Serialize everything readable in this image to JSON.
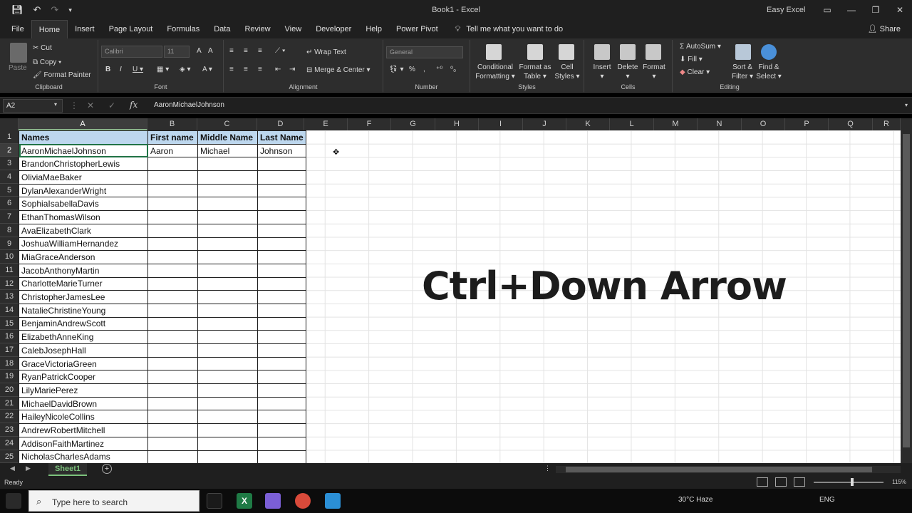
{
  "window": {
    "title": "Book1  -  Excel",
    "user": "Easy Excel"
  },
  "menu": {
    "tabs": [
      "File",
      "Home",
      "Insert",
      "Page Layout",
      "Formulas",
      "Data",
      "Review",
      "View",
      "Developer",
      "Help",
      "Power Pivot"
    ],
    "tell_me": "Tell me what you want to do",
    "share": "Share"
  },
  "ribbon": {
    "clipboard": {
      "label": "Clipboard",
      "paste": "Paste",
      "cut": "Cut",
      "copy": "Copy",
      "format_painter": "Format Painter"
    },
    "font": {
      "label": "Font",
      "font_name": "Calibri",
      "font_size": "11"
    },
    "alignment": {
      "label": "Alignment",
      "wrap_text": "Wrap Text",
      "merge_center": "Merge & Center"
    },
    "number": {
      "label": "Number",
      "format": "General"
    },
    "styles": {
      "label": "Styles",
      "conditional": [
        "Conditional",
        "Formatting"
      ],
      "format_table": [
        "Format as",
        "Table"
      ],
      "cell_styles": [
        "Cell",
        "Styles"
      ]
    },
    "cells": {
      "label": "Cells",
      "insert": "Insert",
      "delete": "Delete",
      "format": "Format"
    },
    "editing": {
      "label": "Editing",
      "autosum": "AutoSum",
      "fill": "Fill",
      "clear": "Clear",
      "sort_filter": [
        "Sort &",
        "Filter"
      ],
      "find_select": [
        "Find &",
        "Select"
      ]
    }
  },
  "formula_bar": {
    "name_box": "A2",
    "content": "AaronMichaelJohnson"
  },
  "grid": {
    "columns": [
      "A",
      "B",
      "C",
      "D",
      "E",
      "F",
      "G",
      "H",
      "I",
      "J",
      "K",
      "L",
      "M",
      "N",
      "O",
      "P",
      "Q",
      "R"
    ],
    "rows": [
      "1",
      "2",
      "3",
      "4",
      "5",
      "6",
      "7",
      "8",
      "9",
      "10",
      "11",
      "12",
      "13",
      "14",
      "15",
      "16",
      "17",
      "18",
      "19",
      "20",
      "21",
      "22",
      "23",
      "24",
      "25"
    ],
    "headers": [
      "Names",
      "First name",
      "Middle Name",
      "Last Name"
    ],
    "data": [
      [
        "AaronMichaelJohnson",
        "Aaron",
        "Michael",
        "Johnson"
      ],
      [
        "BrandonChristopherLewis",
        "",
        "",
        ""
      ],
      [
        "OliviaMaeBaker",
        "",
        "",
        ""
      ],
      [
        "DylanAlexanderWright",
        "",
        "",
        ""
      ],
      [
        "SophiaIsabellaDavis",
        "",
        "",
        ""
      ],
      [
        "EthanThomasWilson",
        "",
        "",
        ""
      ],
      [
        "AvaElizabethClark",
        "",
        "",
        ""
      ],
      [
        "JoshuaWilliamHernandez",
        "",
        "",
        ""
      ],
      [
        "MiaGraceAnderson",
        "",
        "",
        ""
      ],
      [
        "JacobAnthonyMartin",
        "",
        "",
        ""
      ],
      [
        "CharlotteMarieTurner",
        "",
        "",
        ""
      ],
      [
        "ChristopherJamesLee",
        "",
        "",
        ""
      ],
      [
        "NatalieChristineYoung",
        "",
        "",
        ""
      ],
      [
        "BenjaminAndrewScott",
        "",
        "",
        ""
      ],
      [
        "ElizabethAnneKing",
        "",
        "",
        ""
      ],
      [
        "CalebJosephHall",
        "",
        "",
        ""
      ],
      [
        "GraceVictoriaGreen",
        "",
        "",
        ""
      ],
      [
        "RyanPatrickCooper",
        "",
        "",
        ""
      ],
      [
        "LilyMariePerez",
        "",
        "",
        ""
      ],
      [
        "MichaelDavidBrown",
        "",
        "",
        ""
      ],
      [
        "HaileyNicoleCollins",
        "",
        "",
        ""
      ],
      [
        "AndrewRobertMitchell",
        "",
        "",
        ""
      ],
      [
        "AddisonFaithMartinez",
        "",
        "",
        ""
      ],
      [
        "NicholasCharlesAdams",
        "",
        "",
        ""
      ]
    ]
  },
  "overlay": {
    "shortcut": "Ctrl+Down Arrow"
  },
  "sheets": {
    "tabs": [
      "Sheet1"
    ]
  },
  "status": {
    "ready": "Ready",
    "zoom": "115%"
  },
  "taskbar": {
    "search_placeholder": "Type here to search",
    "language": "ENG",
    "weather": "30°C Haze"
  },
  "colors": {
    "accent": "#217346",
    "header_fill": "#bdd7ee",
    "sheet_tab": "#7cc27c"
  }
}
